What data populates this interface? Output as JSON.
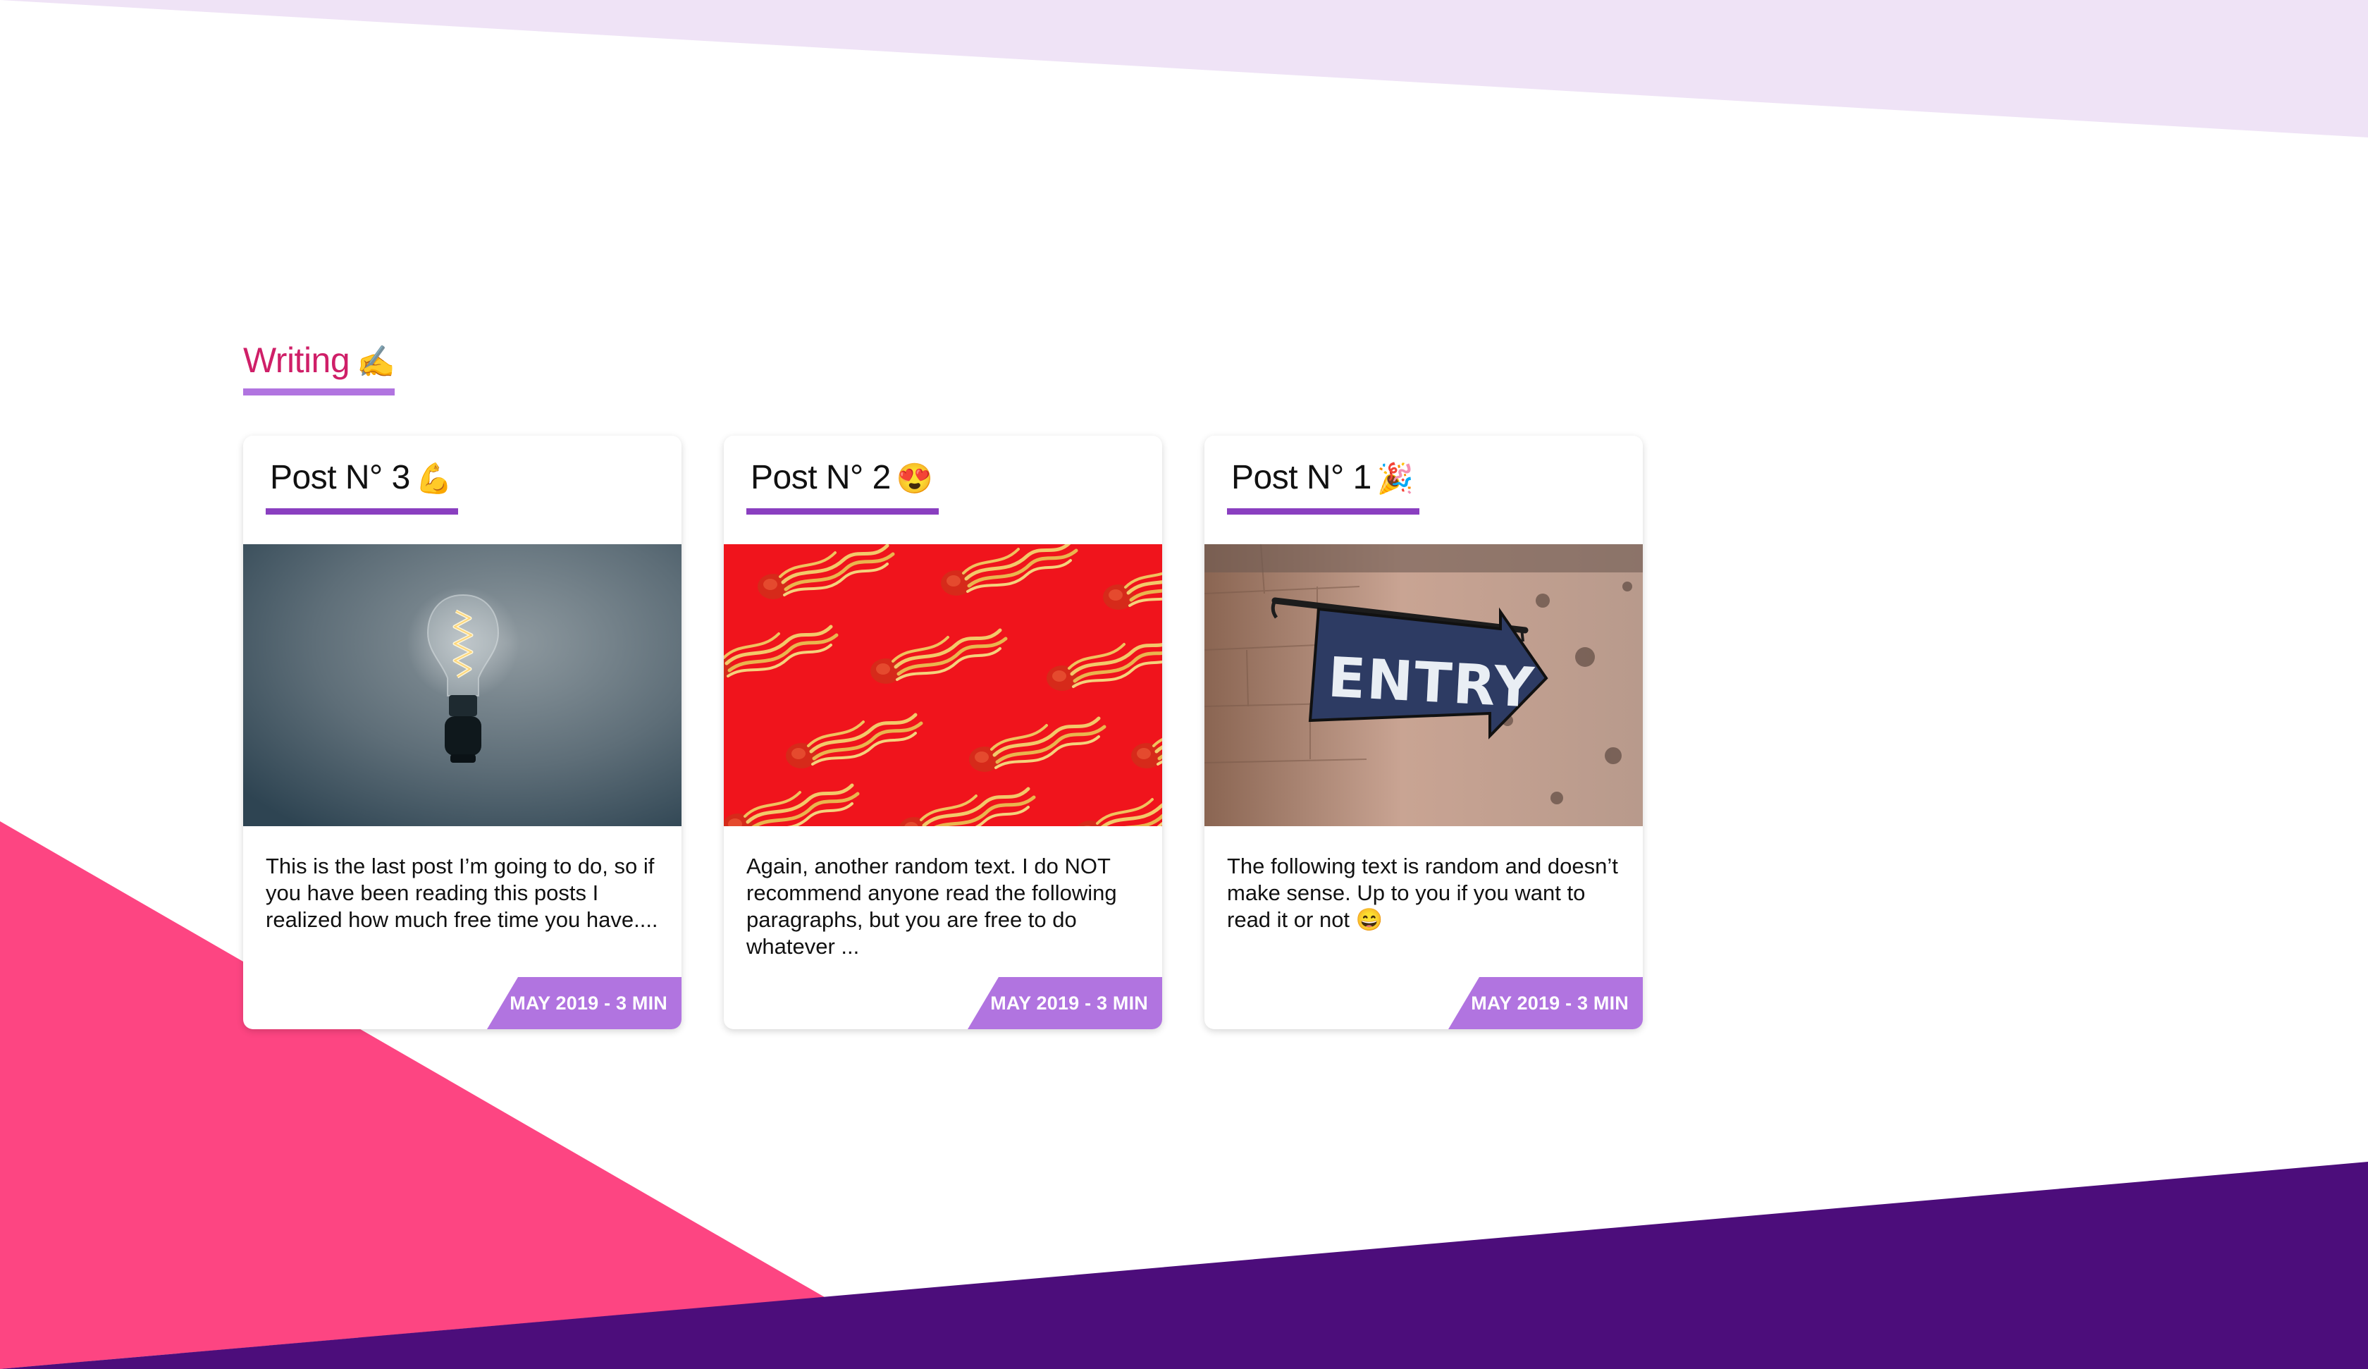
{
  "colors": {
    "accent_pink": "#cf1f68",
    "underline_purple": "#b174e0",
    "title_underline": "#8a3fc0",
    "meta_badge": "#b174e0",
    "bg_lavender": "#efe3f6",
    "bg_pink": "#fd4582",
    "bg_purple": "#4c0d7b"
  },
  "section": {
    "title": "Writing",
    "title_icon": "writing-hand-icon",
    "title_emoji": "✍️"
  },
  "posts": [
    {
      "title": "Post N° 3",
      "emoji": "💪",
      "emoji_icon": "flexed-biceps-icon",
      "image": "lightbulb-photo",
      "excerpt": "This is the last post I’m going to do, so if you have been reading this posts I realized how much free time you have....",
      "meta": "MAY 2019 - 3 MIN"
    },
    {
      "title": "Post N° 2",
      "emoji": "😍",
      "emoji_icon": "heart-eyes-icon",
      "image": "noodles-photo",
      "excerpt": "Again, another random text. I do NOT recommend anyone read the following paragraphs, but you are free to do whatever ...",
      "meta": "MAY 2019 - 3 MIN"
    },
    {
      "title": "Post N° 1",
      "emoji": "🎉",
      "emoji_icon": "party-popper-icon",
      "image": "entry-sign-photo",
      "excerpt": "The following text is random and doesn’t make sense. Up to you if you want to read it or not",
      "excerpt_emoji": "😄",
      "meta": "MAY 2019 - 3 MIN",
      "image_sign_text": "ENTRY"
    }
  ]
}
